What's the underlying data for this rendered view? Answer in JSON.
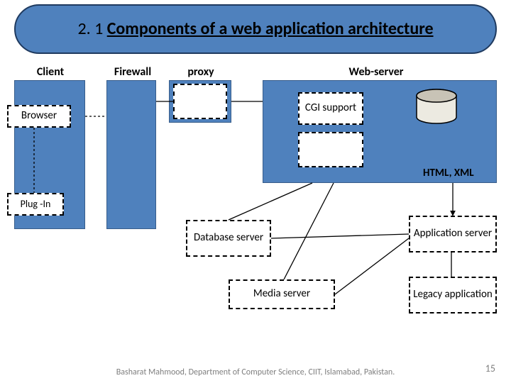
{
  "title_prefix": "2. 1 ",
  "title_bold": "Components of a web application architecture",
  "labels": {
    "client": "Client",
    "firewall": "Firewall",
    "proxy": "proxy",
    "webserver": "Web-server"
  },
  "boxes": {
    "browser": "Browser",
    "plugin": "Plug -In",
    "cgi": "CGI support",
    "dbserver": "Database server",
    "mediaserver": "Media server",
    "appserver": "Application server",
    "legacy": "Legacy application"
  },
  "html_xml": "HTML, XML",
  "footer": "Basharat Mahmood, Department of Computer Science, CIIT, Islamabad, Pakistan.",
  "page": "15"
}
